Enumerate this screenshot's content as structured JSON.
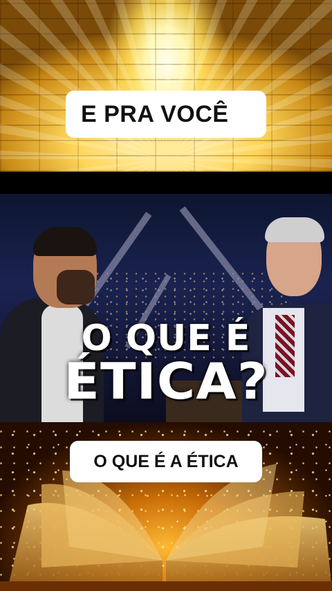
{
  "top_caption": "E PRA VOCÊ",
  "video": {
    "title_line1": "O QUE É",
    "title_line2": "ÉTICA?"
  },
  "bottom_caption": "O QUE É A ÉTICA",
  "colors": {
    "caption_bg": "#ffffff",
    "caption_text": "#111111",
    "gold": "#ffd65a",
    "overlay_text": "#ffffff"
  }
}
